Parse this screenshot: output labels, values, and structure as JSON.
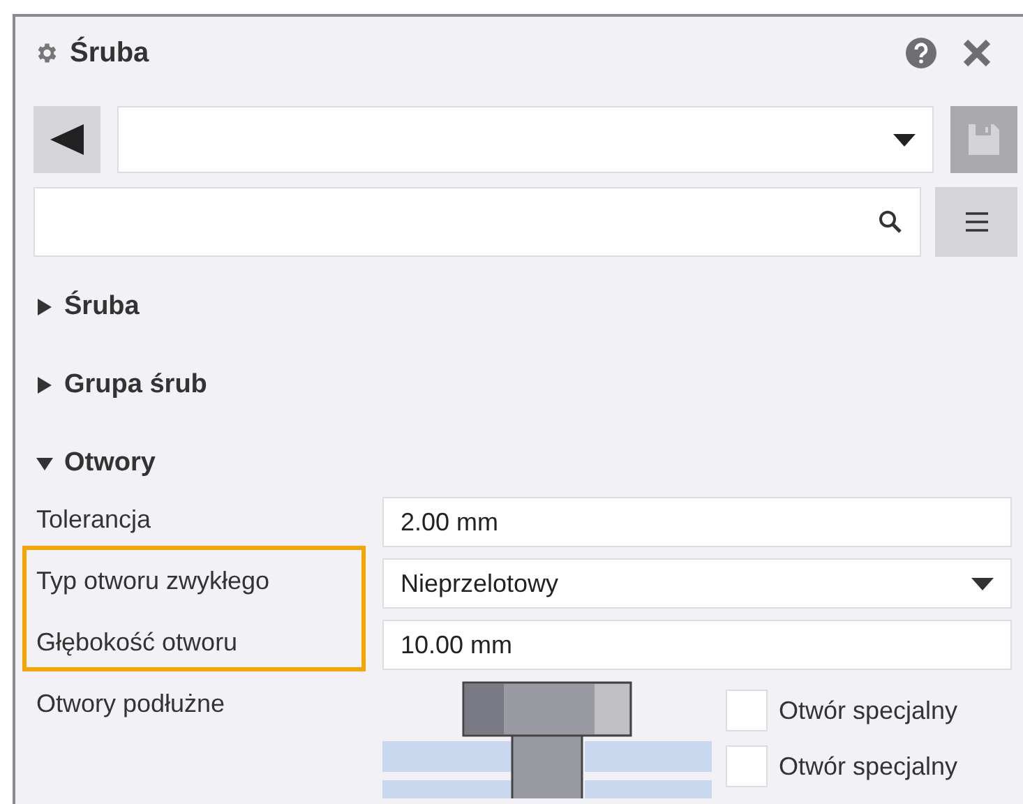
{
  "window": {
    "title": "Śruba"
  },
  "toolbar": {
    "save_disabled": true
  },
  "sections": [
    {
      "title": "Śruba",
      "expanded": false
    },
    {
      "title": "Grupa śrub",
      "expanded": false
    },
    {
      "title": "Otwory",
      "expanded": true
    }
  ],
  "properties": [
    {
      "kind": "text",
      "label": "Tolerancja",
      "value": "2.00 mm",
      "highlighted": false
    },
    {
      "kind": "select",
      "label": "Typ otworu zwykłego",
      "value": "Nieprzelotowy",
      "highlighted": true
    },
    {
      "kind": "text",
      "label": "Głębokość otworu",
      "value": "10.00 mm",
      "highlighted": true
    },
    {
      "kind": "slot",
      "label": "Otwory podłużne",
      "options": [
        {
          "label": "Otwór specjalny",
          "checked": false
        },
        {
          "label": "Otwór specjalny",
          "checked": false
        }
      ],
      "highlighted": false
    }
  ]
}
